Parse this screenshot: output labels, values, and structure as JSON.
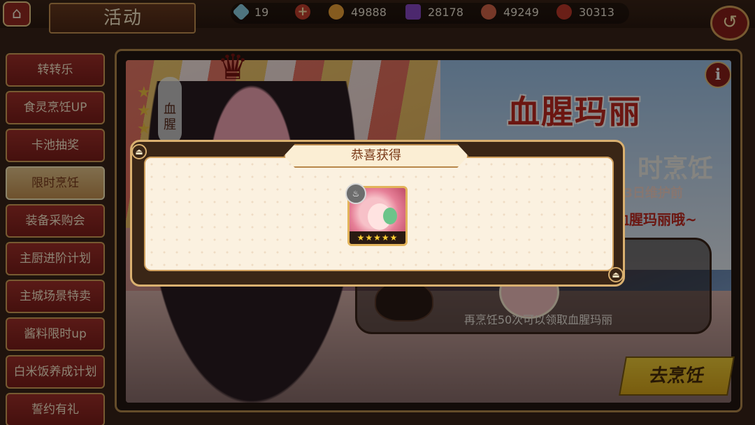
{
  "header": {
    "title": "活动",
    "home_icon": "house-icon",
    "back_icon": "return-arrow-icon"
  },
  "resources": [
    {
      "name": "diamond",
      "icon": "diamond-icon",
      "value": "19",
      "color": "#8fd3e8"
    },
    {
      "name": "potion",
      "icon": "potion-flask-icon",
      "value": "49888",
      "color": "#f2a63a"
    },
    {
      "name": "gem",
      "icon": "purple-gem-icon",
      "value": "28178",
      "color": "#8a4ac8"
    },
    {
      "name": "food",
      "icon": "dish-icon",
      "value": "49249",
      "color": "#d8664a"
    },
    {
      "name": "drum",
      "icon": "drum-icon",
      "value": "30313",
      "color": "#c23a2a"
    }
  ],
  "sidebar": {
    "items": [
      {
        "label": "转转乐",
        "active": false
      },
      {
        "label": "食灵烹饪UP",
        "active": false
      },
      {
        "label": "卡池抽奖",
        "active": false
      },
      {
        "label": "限时烹饪",
        "active": true
      },
      {
        "label": "装备采购会",
        "active": false
      },
      {
        "label": "主厨进阶计划",
        "active": false
      },
      {
        "label": "主城场景特卖",
        "active": false
      },
      {
        "label": "酱料限时up",
        "active": false
      },
      {
        "label": "白米饭养成计划",
        "active": false
      },
      {
        "label": "誓约有礼",
        "active": false
      }
    ]
  },
  "event": {
    "title": "血腥玛丽",
    "subtitle": "时烹饪",
    "date_text": "23日维护前",
    "hint_text": "血腥玛丽哦~",
    "character_tag": "血腥",
    "reward_text": "再烹饪50次可以领取血腥玛丽",
    "cook_button": "去烹饪",
    "info_icon": "i"
  },
  "modal": {
    "title": "恭喜获得",
    "item_stars": "★★★★★",
    "badge_icon": "steam-bowl-icon"
  }
}
